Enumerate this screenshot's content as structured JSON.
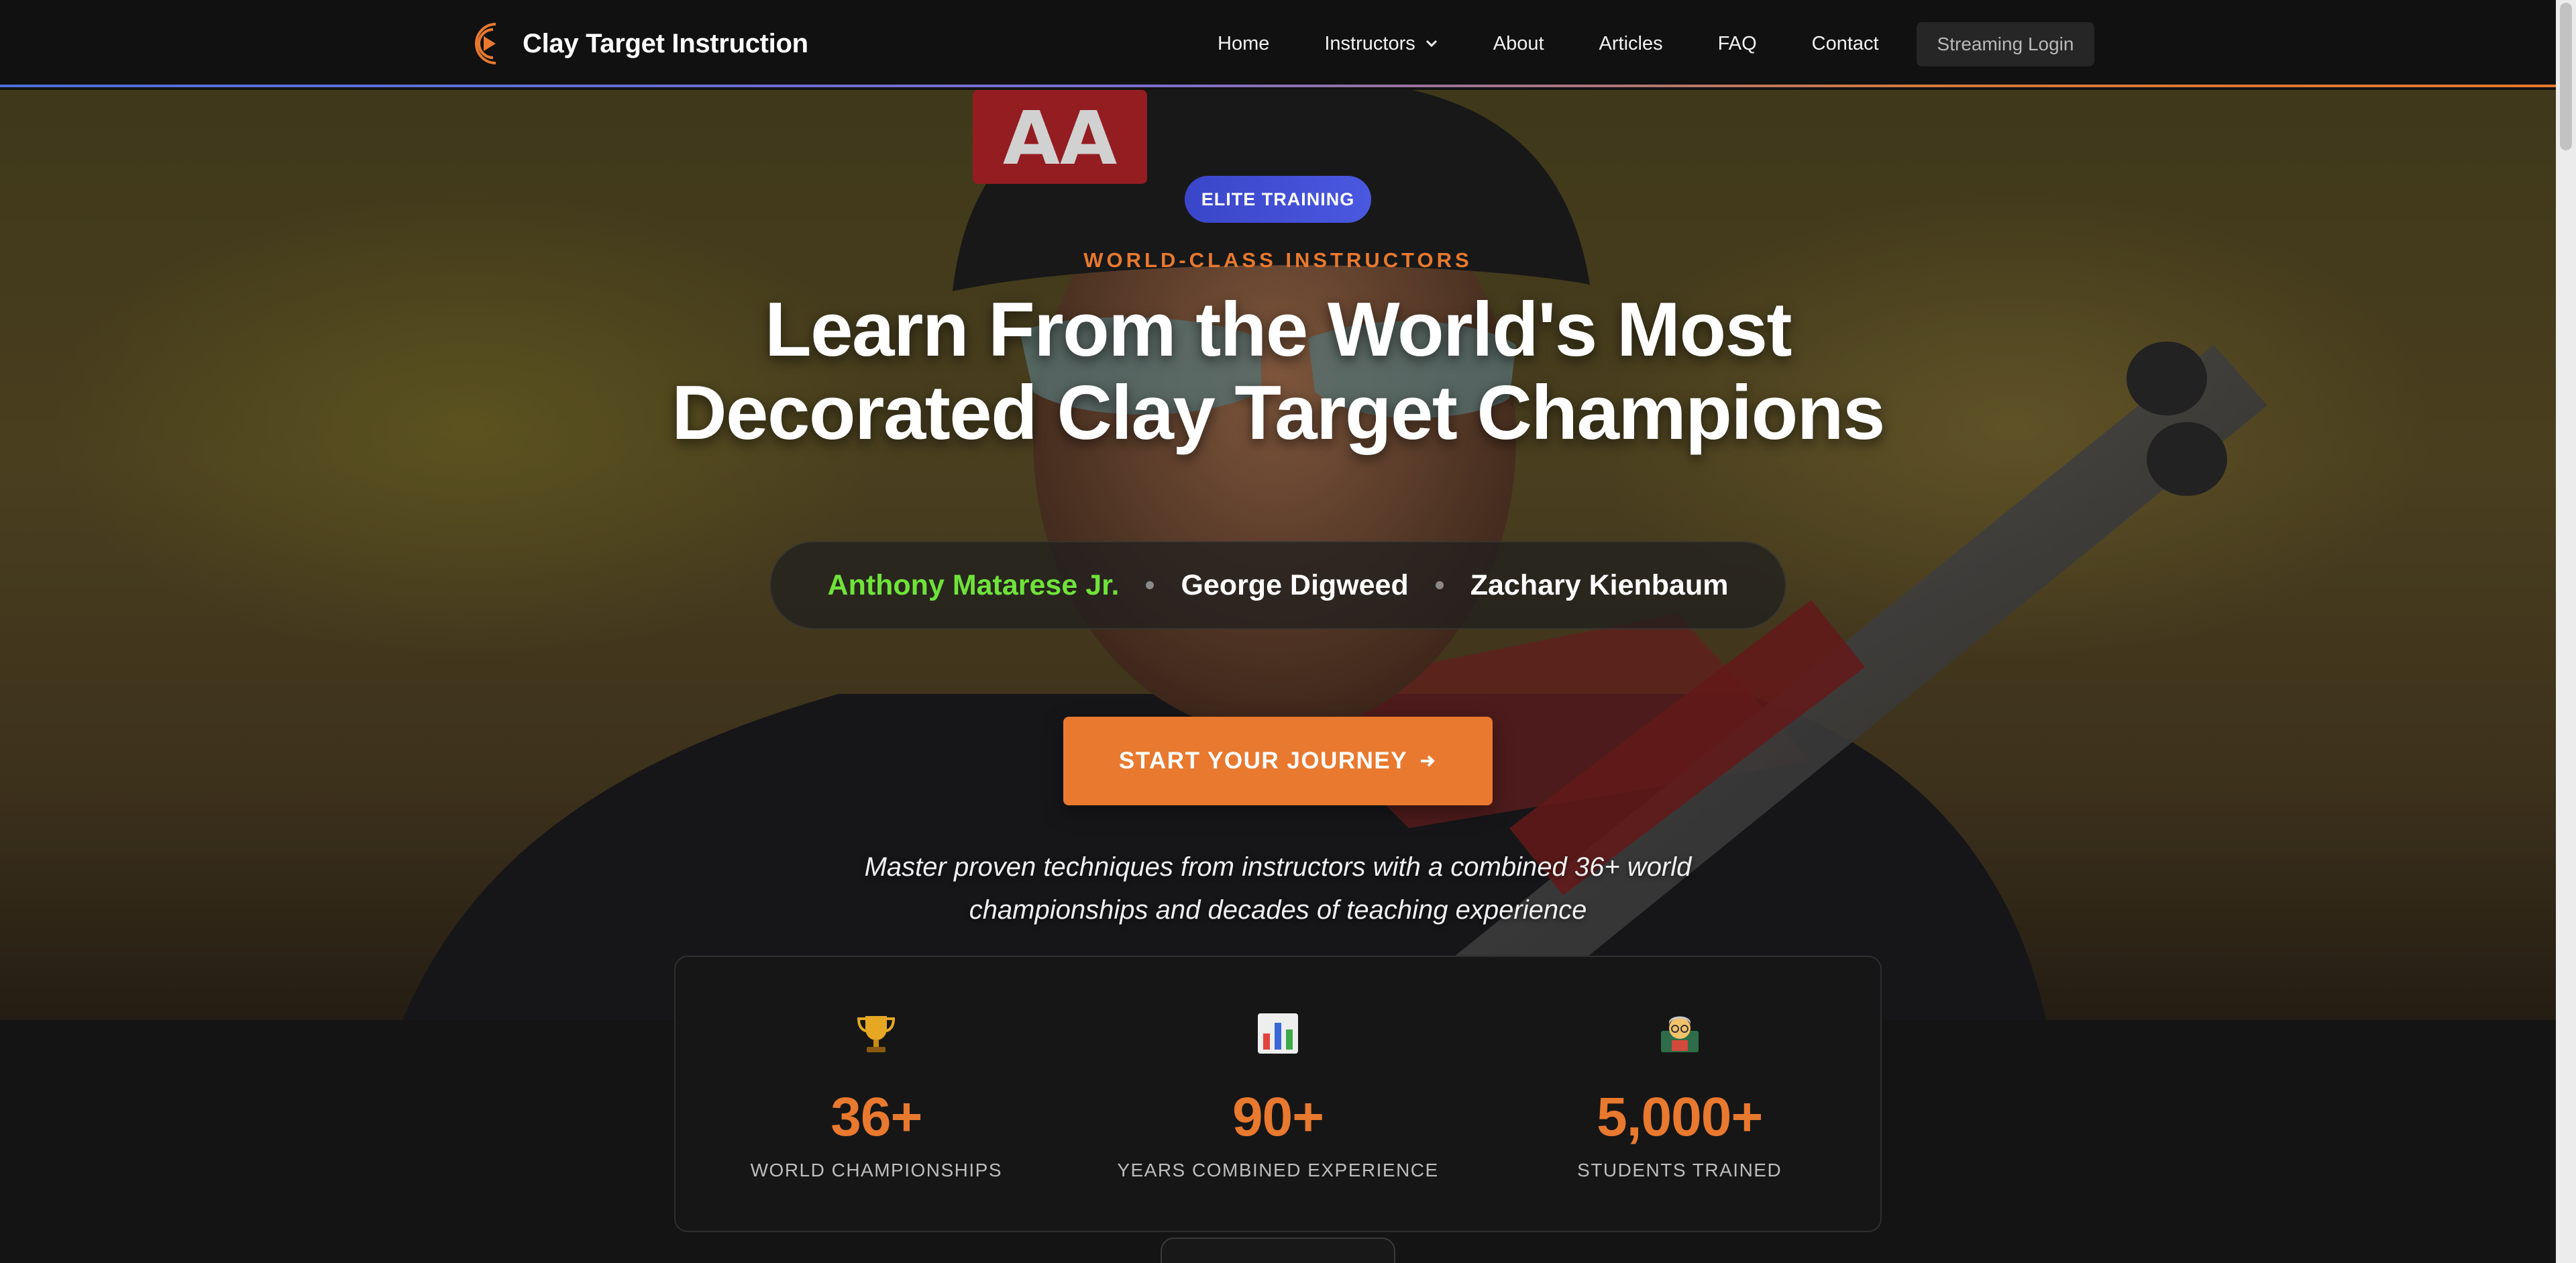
{
  "nav": {
    "brand": "Clay Target Instruction",
    "links": [
      "Home",
      "Instructors",
      "About",
      "Articles",
      "FAQ",
      "Contact"
    ],
    "streaming_login": "Streaming Login"
  },
  "hero": {
    "badge": "ELITE TRAINING",
    "eyebrow": "WORLD-CLASS INSTRUCTORS",
    "headline_line1": "Learn From the World's Most",
    "headline_line2": "Decorated Clay Target Champions",
    "instructors": [
      "Anthony Matarese Jr.",
      "George Digweed",
      "Zachary Kienbaum"
    ],
    "cta": "START YOUR JOURNEY",
    "tagline_line1": "Master proven techniques from instructors with a combined 36+ world",
    "tagline_line2": "championships and decades of teaching experience"
  },
  "stats": [
    {
      "icon": "trophy-icon",
      "value": "36+",
      "label": "WORLD CHAMPIONSHIPS"
    },
    {
      "icon": "bar-chart-icon",
      "value": "90+",
      "label": "YEARS COMBINED EXPERIENCE"
    },
    {
      "icon": "teacher-icon",
      "value": "5,000+",
      "label": "STUDENTS TRAINED"
    }
  ],
  "colors": {
    "accent": "#e8792f",
    "badge": "#4452d8",
    "active_name": "#6fe33a",
    "background": "#141414"
  }
}
